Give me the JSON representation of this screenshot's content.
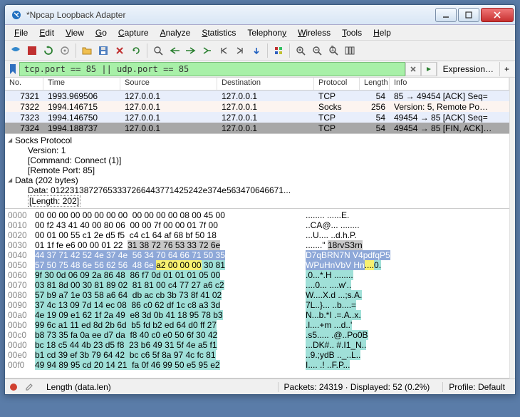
{
  "title": "*Npcap Loopback Adapter",
  "menu": [
    "File",
    "Edit",
    "View",
    "Go",
    "Capture",
    "Analyze",
    "Statistics",
    "Telephony",
    "Wireless",
    "Tools",
    "Help"
  ],
  "filter": {
    "value": "tcp.port == 85 || udp.port == 85",
    "expression": "Expression…"
  },
  "columns": [
    "No.",
    "Time",
    "Source",
    "Destination",
    "Protocol",
    "Length",
    "Info"
  ],
  "packets": [
    {
      "no": "7321",
      "time": "1993.969506",
      "src": "127.0.0.1",
      "dst": "127.0.0.1",
      "proto": "TCP",
      "len": "54",
      "info": "85 → 49454 [ACK] Seq=",
      "cls": "tcp"
    },
    {
      "no": "7322",
      "time": "1994.146715",
      "src": "127.0.0.1",
      "dst": "127.0.0.1",
      "proto": "Socks",
      "len": "256",
      "info": "Version: 5, Remote Po…",
      "cls": "socks"
    },
    {
      "no": "7323",
      "time": "1994.146750",
      "src": "127.0.0.1",
      "dst": "127.0.0.1",
      "proto": "TCP",
      "len": "54",
      "info": "49454 → 85 [ACK] Seq=",
      "cls": "tcp"
    },
    {
      "no": "7324",
      "time": "1994.188737",
      "src": "127.0.0.1",
      "dst": "127.0.0.1",
      "proto": "TCP",
      "len": "54",
      "info": "49454 → 85 [FIN, ACK]…",
      "cls": "sel"
    }
  ],
  "details": {
    "h1": "Socks Protocol",
    "r1": "Version: 1",
    "r2": "[Command: Connect (1)]",
    "r3": "[Remote Port: 85]",
    "h2": "Data (202 bytes)",
    "r4": "Data: 01223138727653337266443771425242e374e563470646671...",
    "r5": "[Length: 202]"
  },
  "hex": [
    {
      "off": "0000",
      "b": "00 00 00 00 00 00 00 00  00 00 00 00 08 00 45 00",
      "a": "........ ......E."
    },
    {
      "off": "0010",
      "b": "00 f2 43 41 40 00 80 06  00 00 7f 00 00 01 7f 00",
      "a": "..CA@... ........"
    },
    {
      "off": "0020",
      "b": "00 01 00 55 c1 2e d5 f5  c4 c1 64 af 68 bf 50 18",
      "a": "...U.... ..d.h.P."
    },
    {
      "off": "0030",
      "b": "01 1f fe e6 00 00 01 22  ",
      "a": ".......\" ",
      "b2": "31 38 72 76 53 33 72 6e",
      "a2": "18rvS3rn",
      "row_hl": "gray"
    },
    {
      "off": "0040",
      "b": "44 37 71 42 52 4e 37 4e  56 34 70 64 66 71 50 35",
      "a": "D7qBRN7N V4pdfqP5",
      "row_hl": "blue"
    },
    {
      "off": "0050",
      "b": "57 50 75 48 6e 56 62 56  48 6e ",
      "a": "WPuHnVbV Hn",
      "b2": "a2 00 00 00",
      "b3": " 30 81",
      "a2": "....",
      "a3": "0.",
      "row_hl": "blue",
      "yel": true
    },
    {
      "off": "0060",
      "b": "9f 30 0d 06 09 2a 86 48  86 f7 0d 01 01 01 05 00",
      "a": ".0...*.H ........",
      "row_hl": "teal"
    },
    {
      "off": "0070",
      "b": "03 81 8d 00 30 81 89 02  81 81 00 c4 77 27 a6 c2",
      "a": "....0... ....w'..",
      "row_hl": "teal"
    },
    {
      "off": "0080",
      "b": "57 b9 a7 1e 03 58 a6 64  db ac cb 3b 73 8f 41 02",
      "a": "W....X.d ...;s.A.",
      "row_hl": "teal"
    },
    {
      "off": "0090",
      "b": "37 4c 13 09 7d 14 ec 08  86 c0 62 df 1c c8 a3 3d",
      "a": "7L..}... ..b....=",
      "row_hl": "teal"
    },
    {
      "off": "00a0",
      "b": "4e 19 09 e1 62 1f 2a 49  e8 3d 0b 41 18 95 78 b3",
      "a": "N...b.*I .=.A..x.",
      "row_hl": "teal"
    },
    {
      "off": "00b0",
      "b": "99 6c a1 11 ed 8d 2b 6d  b5 fd b2 ed 64 d0 ff 27",
      "a": ".l....+m ...d..'",
      "row_hl": "teal"
    },
    {
      "off": "00c0",
      "b": "b8 73 35 fa 0a ee d7 da  f8 40 c0 e0 50 6f 30 42",
      "a": ".s5..... .@..Po0B",
      "row_hl": "teal"
    },
    {
      "off": "00d0",
      "b": "bc 18 c5 44 4b 23 d5 f8  23 b6 49 31 5f 4e a5 f1",
      "a": "...DK#.. #.I1_N..",
      "row_hl": "teal"
    },
    {
      "off": "00e0",
      "b": "b1 cd 39 ef 3b 79 64 42  bc c6 5f 8a 97 4c fc 81",
      "a": "..9.;ydB .._..L..",
      "row_hl": "teal"
    },
    {
      "off": "00f0",
      "b": "49 94 89 95 cd 20 14 21  fa 0f 46 99 50 e5 95 e2",
      "a": "I.... .! ..F.P...",
      "row_hl": "teal"
    }
  ],
  "status": {
    "field": "Length (data.len)",
    "packets": "Packets: 24319 · Displayed: 52 (0.2%)",
    "profile": "Profile: Default"
  }
}
